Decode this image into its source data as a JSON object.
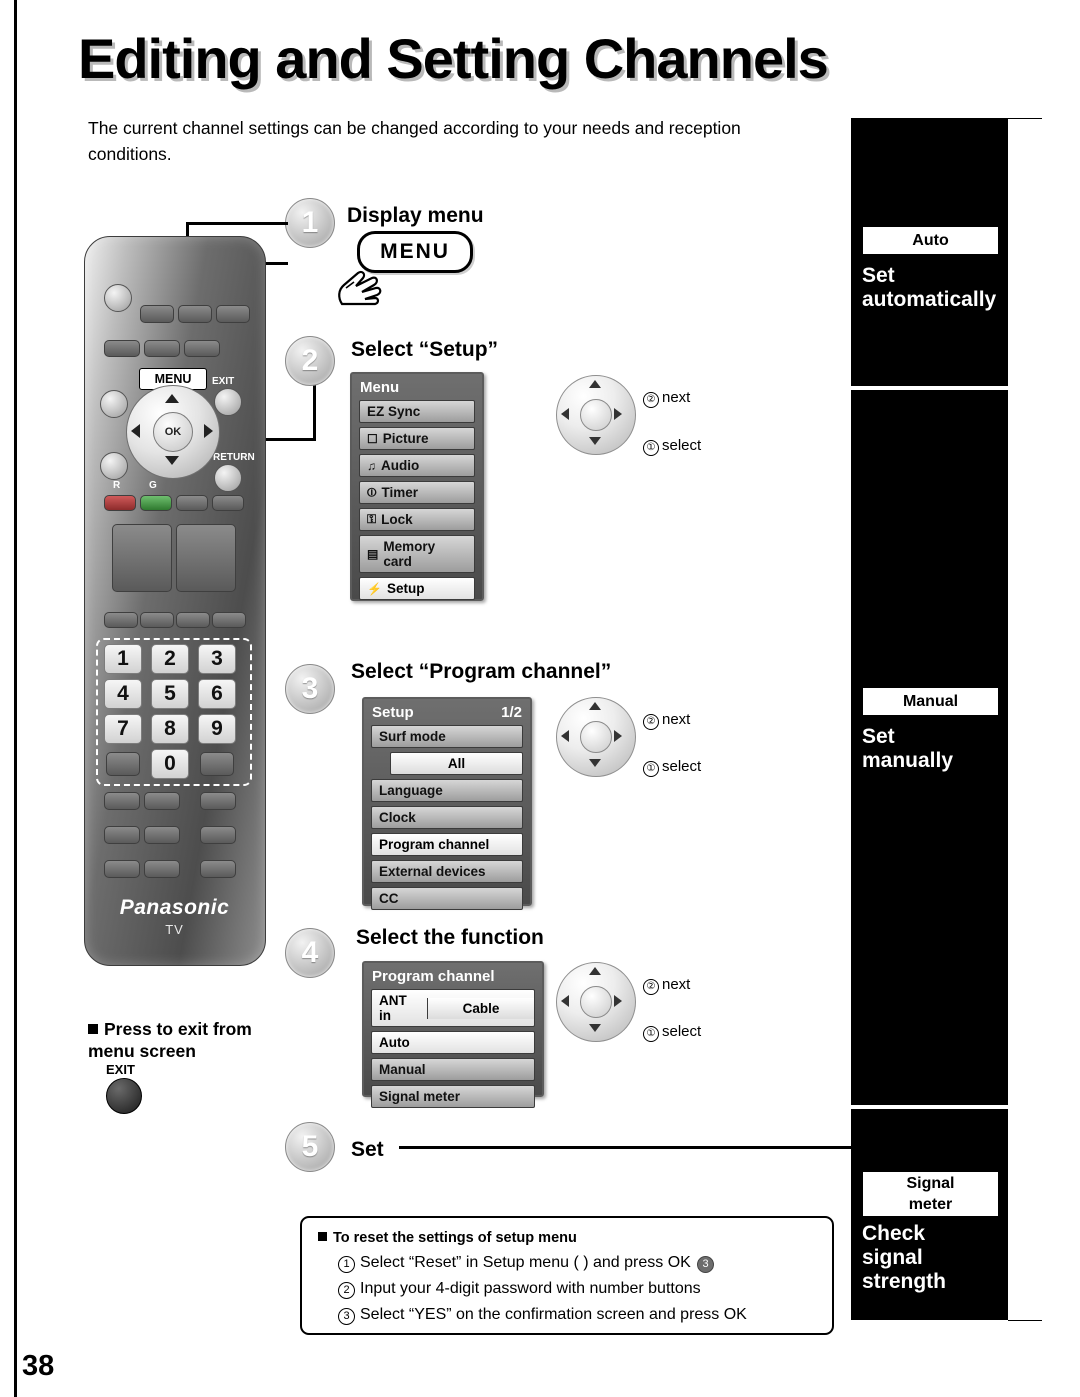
{
  "page": {
    "number": "38",
    "title": "Editing and Setting Channels",
    "intro": "The current channel settings can be changed according to your needs and reception conditions."
  },
  "steps": [
    {
      "num": "1",
      "label": "Display menu"
    },
    {
      "num": "2",
      "label": "Select “Setup”"
    },
    {
      "num": "3",
      "label": "Select “Program channel”"
    },
    {
      "num": "4",
      "label": "Select the function"
    },
    {
      "num": "5",
      "label": "Set"
    }
  ],
  "menu_bubble": "MENU",
  "remote": {
    "menu_button": "MENU",
    "exit_button": "EXIT",
    "return_button": "RETURN",
    "ok_button": "OK",
    "color_buttons": [
      "R",
      "G"
    ],
    "number_keys": [
      "1",
      "2",
      "3",
      "4",
      "5",
      "6",
      "7",
      "8",
      "9",
      "0"
    ],
    "brand": "Panasonic",
    "brand_sub": "TV"
  },
  "exit_note": {
    "text": "Press to exit from menu screen",
    "button": "EXIT"
  },
  "osd_menu": {
    "title": "Menu",
    "items": [
      {
        "icon": "",
        "label": "EZ Sync",
        "selected": false
      },
      {
        "icon": "☐",
        "label": "Picture",
        "selected": false
      },
      {
        "icon": "♫",
        "label": "Audio",
        "selected": false
      },
      {
        "icon": "⏼",
        "label": "Timer",
        "selected": false
      },
      {
        "icon": "⚿",
        "label": "Lock",
        "selected": false
      },
      {
        "icon": "▤",
        "label": "Memory card",
        "selected": false
      },
      {
        "icon": "⚡",
        "label": "Setup",
        "selected": true
      }
    ]
  },
  "osd_setup": {
    "title": "Setup",
    "page": "1/2",
    "items": [
      {
        "label": "Surf mode",
        "sub": "All",
        "selected": false
      },
      {
        "label": "Language",
        "sub": null,
        "selected": false
      },
      {
        "label": "Clock",
        "sub": null,
        "selected": false
      },
      {
        "label": "Program channel",
        "sub": null,
        "selected": true
      },
      {
        "label": "External devices",
        "sub": null,
        "selected": false
      },
      {
        "label": "CC",
        "sub": null,
        "selected": false
      }
    ]
  },
  "osd_program": {
    "title": "Program channel",
    "rows": [
      {
        "label": "ANT in",
        "value": "Cable"
      },
      {
        "label": "Auto",
        "value": null
      },
      {
        "label": "Manual",
        "value": null
      },
      {
        "label": "Signal meter",
        "value": null
      }
    ]
  },
  "nav_hints": [
    {
      "next": "next",
      "select": "select"
    },
    {
      "next": "next",
      "select": "select"
    },
    {
      "next": "next",
      "select": "select"
    }
  ],
  "hint_numbers": {
    "one": "①",
    "two": "②"
  },
  "right_panels": [
    {
      "tab": "Auto",
      "caption_line1": "Set",
      "caption_line2": "automatically"
    },
    {
      "tab": "Manual",
      "caption_line1": "Set",
      "caption_line2": "manually"
    },
    {
      "tab_line1": "Signal",
      "tab_line2": "meter",
      "caption_line1": "Check",
      "caption_line2": "signal",
      "caption_line3": "strength"
    }
  ],
  "reset_box": {
    "title": "To reset the settings of setup menu",
    "lines": [
      "Select “Reset” in Setup menu (    ) and press OK",
      "Input your 4-digit password with number buttons",
      "Select “YES” on the confirmation screen and press OK"
    ],
    "inline_step": "3"
  }
}
